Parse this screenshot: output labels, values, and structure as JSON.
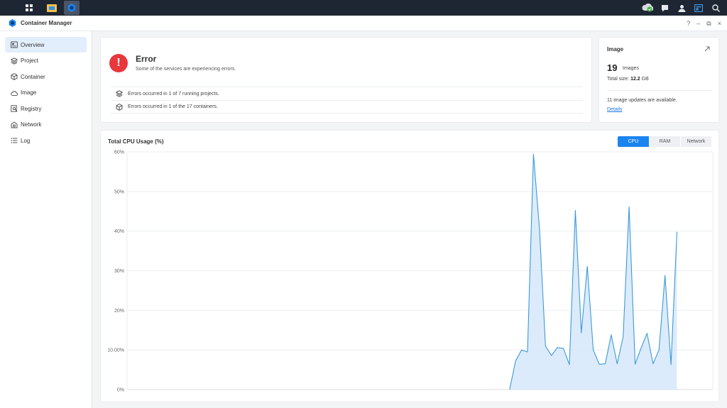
{
  "window": {
    "title": "Container Manager",
    "controls": [
      "?",
      "–",
      "⧉",
      "×"
    ]
  },
  "sidebar": {
    "items": [
      {
        "label": "Overview",
        "icon": "overview-icon",
        "active": true
      },
      {
        "label": "Project",
        "icon": "project-icon",
        "active": false
      },
      {
        "label": "Container",
        "icon": "container-icon",
        "active": false
      },
      {
        "label": "Image",
        "icon": "cloud-icon",
        "active": false
      },
      {
        "label": "Registry",
        "icon": "registry-icon",
        "active": false
      },
      {
        "label": "Network",
        "icon": "network-icon",
        "active": false
      },
      {
        "label": "Log",
        "icon": "log-icon",
        "active": false
      }
    ]
  },
  "error_card": {
    "title": "Error",
    "subtitle": "Some of the services are experiencing errors.",
    "rows": [
      "Errors occurred in 1 of 7 running projects.",
      "Errors occurred in 1 of the 17 containers."
    ]
  },
  "image_card": {
    "title": "Image",
    "count": "19",
    "count_label": "Images",
    "size_label": "Total size:",
    "size_value": "12.2",
    "size_unit": "GB",
    "updates": "11 image updates are available.",
    "details": "Details"
  },
  "cpu_card": {
    "title": "Total CPU Usage (%)",
    "tabs": [
      "CPU",
      "RAM",
      "Network"
    ],
    "active_tab": "CPU"
  },
  "colors": {
    "accent": "#1a84f0",
    "error": "#e8373d",
    "line": "#3b9ad9",
    "fill": "#d6e8fa"
  },
  "chart_data": {
    "type": "area",
    "title": "Total CPU Usage (%)",
    "y_tick_labels": [
      "60%",
      "50%",
      "40%",
      "30%",
      "20%",
      "10.00%",
      "0%"
    ],
    "ylim": [
      0,
      60
    ],
    "x": [
      0,
      1,
      2,
      3,
      4,
      5,
      6,
      7,
      8,
      9,
      10,
      11,
      12,
      13,
      14,
      15,
      16,
      17,
      18,
      19,
      20,
      21,
      22,
      23,
      24,
      25,
      26,
      27,
      28,
      29,
      30,
      31,
      32,
      33,
      34,
      35,
      36,
      37,
      38,
      39,
      40,
      41,
      42,
      43,
      44,
      45,
      46,
      47,
      48,
      49,
      50,
      51,
      52,
      53,
      54,
      55,
      56,
      57,
      58,
      59,
      60,
      61,
      62,
      63,
      64,
      65,
      66,
      67,
      68,
      69,
      70,
      71,
      72,
      73,
      74,
      75,
      76,
      77,
      78,
      79,
      80,
      81,
      82,
      83,
      84,
      85,
      86,
      87,
      88,
      89,
      90,
      91,
      92,
      93,
      94,
      95,
      96,
      97,
      98
    ],
    "values": [
      null,
      null,
      null,
      null,
      null,
      null,
      null,
      null,
      null,
      null,
      null,
      null,
      null,
      null,
      null,
      null,
      null,
      null,
      null,
      null,
      null,
      null,
      null,
      null,
      null,
      null,
      null,
      null,
      null,
      null,
      null,
      null,
      null,
      null,
      null,
      null,
      null,
      null,
      null,
      null,
      null,
      null,
      null,
      null,
      null,
      null,
      null,
      null,
      null,
      null,
      null,
      null,
      null,
      null,
      null,
      null,
      null,
      null,
      null,
      null,
      null,
      null,
      null,
      null,
      0,
      7.2,
      10,
      9.5,
      59.4,
      40.5,
      11,
      8.6,
      10.6,
      10.4,
      6.3,
      45.2,
      14.3,
      31.1,
      10,
      6.4,
      6.5,
      13.8,
      6.5,
      13.3,
      46.1,
      6.4,
      10.5,
      14.2,
      6.5,
      10,
      28.8,
      6.3,
      39.8,
      null,
      null,
      null,
      null,
      null,
      null
    ],
    "grid": true
  }
}
